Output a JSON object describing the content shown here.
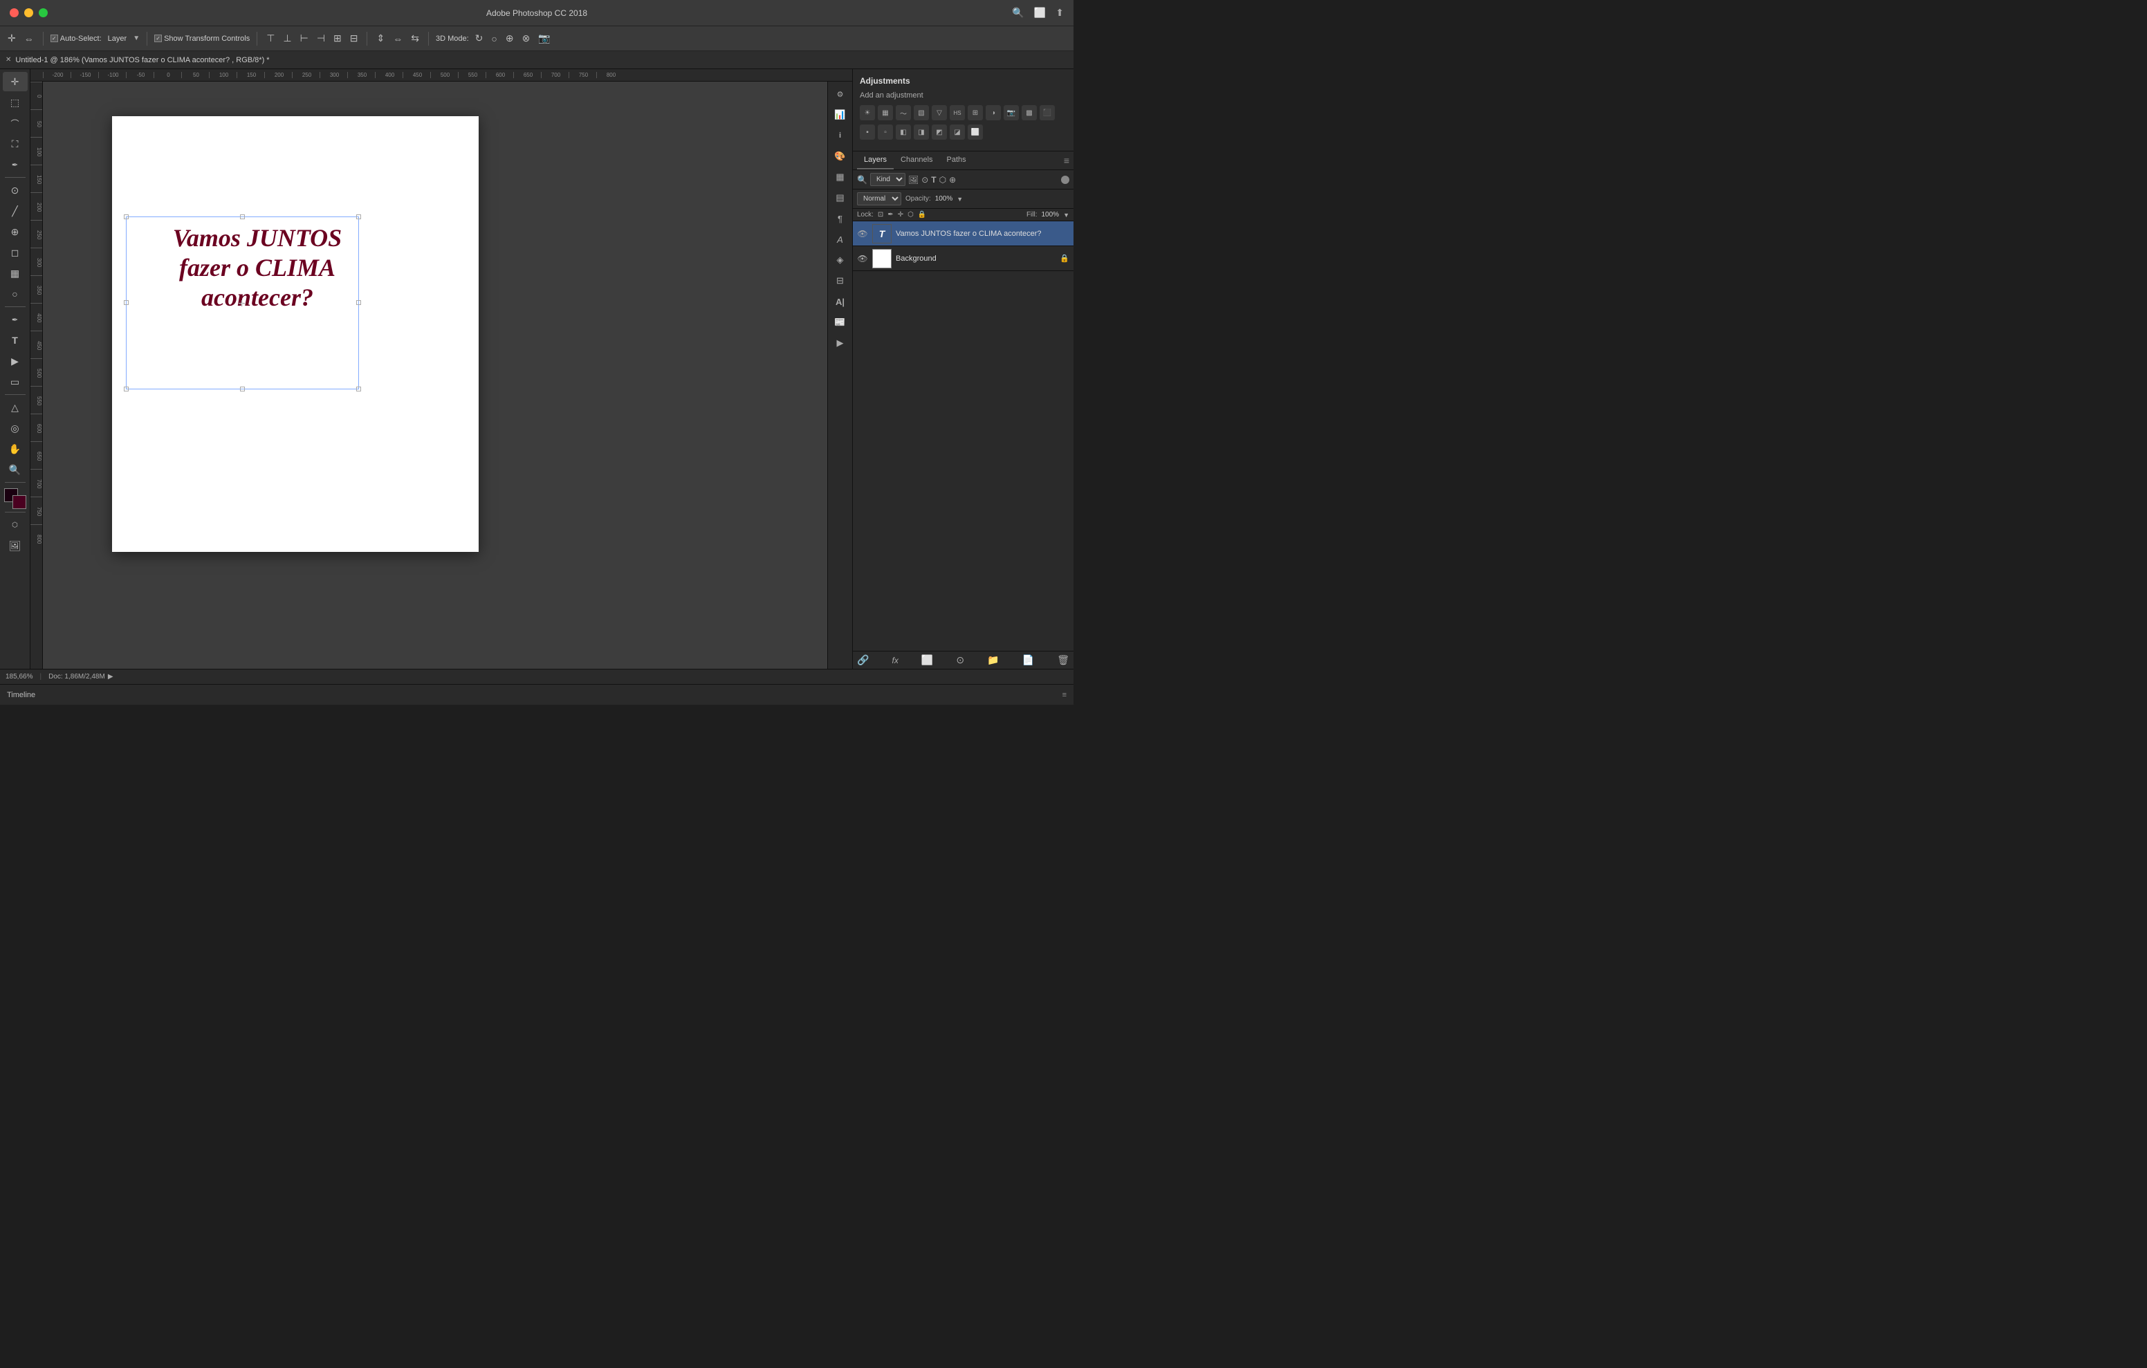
{
  "app": {
    "title": "Adobe Photoshop CC 2018",
    "tab_title": "Untitled-1 @ 186% (Vamos JUNTOS fazer o CLIMA acontecer? , RGB/8*) *"
  },
  "titlebar": {
    "close_label": "×",
    "search_icon": "🔍",
    "window_icon": "⬜",
    "share_icon": "⬆"
  },
  "toolbar": {
    "auto_select_label": "Auto-Select:",
    "layer_label": "Layer",
    "show_transform_label": "Show Transform Controls",
    "threeD_mode_label": "3D Mode:"
  },
  "left_tools": [
    {
      "name": "move",
      "icon": "✛"
    },
    {
      "name": "selection",
      "icon": "⬚"
    },
    {
      "name": "lasso",
      "icon": "⌖"
    },
    {
      "name": "crop",
      "icon": "⛶"
    },
    {
      "name": "eyedropper",
      "icon": "✒"
    },
    {
      "name": "spot-heal",
      "icon": "⊙"
    },
    {
      "name": "brush",
      "icon": "🖌"
    },
    {
      "name": "clone",
      "icon": "⊕"
    },
    {
      "name": "eraser",
      "icon": "◻"
    },
    {
      "name": "gradient",
      "icon": "▦"
    },
    {
      "name": "dodge",
      "icon": "○"
    },
    {
      "name": "pen",
      "icon": "✏"
    },
    {
      "name": "text",
      "icon": "T"
    },
    {
      "name": "path-select",
      "icon": "▶"
    },
    {
      "name": "shape",
      "icon": "▭"
    },
    {
      "name": "anchor",
      "icon": "△"
    },
    {
      "name": "focus",
      "icon": "◎"
    },
    {
      "name": "hand",
      "icon": "✋"
    },
    {
      "name": "zoom",
      "icon": "🔍"
    }
  ],
  "canvas": {
    "text_content": "Vamos JUNTOS fazer o CLIMA acontecer?",
    "text_color": "#6b0020",
    "zoom_level": "185,66%",
    "doc_size": "Doc: 1,86M/2,48M"
  },
  "ruler": {
    "top_marks": [
      "-200",
      "-150",
      "-100",
      "-50",
      "0",
      "50",
      "100",
      "150",
      "200",
      "250",
      "300",
      "350",
      "400",
      "450",
      "500",
      "550",
      "600",
      "650",
      "700",
      "750",
      "800"
    ],
    "left_marks": [
      "0",
      "50",
      "100",
      "150",
      "200",
      "250",
      "300",
      "350",
      "400",
      "450",
      "500",
      "550",
      "600",
      "650",
      "700",
      "750",
      "800"
    ]
  },
  "adjustments_panel": {
    "title": "Adjustments",
    "subtitle": "Add an adjustment",
    "icons": [
      "☀",
      "▦",
      "▤",
      "▧",
      "▽",
      "◑",
      "▣",
      "▩",
      "⊞",
      "⊟",
      "⊠",
      "⬛",
      "▪",
      "▫",
      "◧",
      "◨",
      "◩",
      "◪"
    ]
  },
  "layers_panel": {
    "tabs": [
      {
        "label": "Layers",
        "active": true
      },
      {
        "label": "Channels",
        "active": false
      },
      {
        "label": "Paths",
        "active": false
      }
    ],
    "filter_label": "Kind",
    "opacity_label": "Opacity:",
    "opacity_value": "100%",
    "blend_mode": "Normal",
    "fill_label": "Fill:",
    "fill_value": "100%",
    "lock_label": "Lock:",
    "layers": [
      {
        "name": "Vamos JUNTOS fazer o CLIMA acontecer?",
        "type": "text",
        "visible": true,
        "selected": true,
        "thumb_text": "T"
      },
      {
        "name": "Background",
        "type": "image",
        "visible": true,
        "selected": false,
        "locked": true,
        "thumb_text": ""
      }
    ]
  },
  "timeline": {
    "label": "Timeline"
  },
  "panel_icons": {
    "icons": [
      "⚙",
      "📊",
      "🖊",
      "⬛",
      "🔲",
      "▶"
    ]
  }
}
